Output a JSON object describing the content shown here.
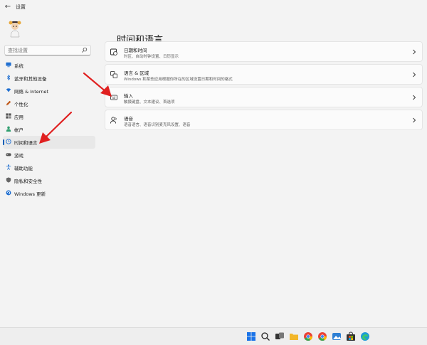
{
  "window": {
    "title": "设置"
  },
  "search": {
    "placeholder": "查找设置"
  },
  "sidebar": {
    "items": [
      {
        "label": "系统",
        "icon": "monitor-icon",
        "color": "#1f6fd1"
      },
      {
        "label": "蓝牙和其他设备",
        "icon": "bluetooth-icon",
        "color": "#1f6fd1"
      },
      {
        "label": "网络 & Internet",
        "icon": "wifi-icon",
        "color": "#1f6fd1"
      },
      {
        "label": "个性化",
        "icon": "pen-icon",
        "color": "#c05a1c"
      },
      {
        "label": "应用",
        "icon": "apps-icon",
        "color": "#555555"
      },
      {
        "label": "帐户",
        "icon": "person-icon",
        "color": "#2f9e6e"
      },
      {
        "label": "时间和语言",
        "icon": "globe-clock-icon",
        "color": "#1f6fd1",
        "selected": true
      },
      {
        "label": "游戏",
        "icon": "gamepad-icon",
        "color": "#555555"
      },
      {
        "label": "辅助功能",
        "icon": "accessibility-icon",
        "color": "#1f6fd1"
      },
      {
        "label": "隐私和安全性",
        "icon": "shield-icon",
        "color": "#555555"
      },
      {
        "label": "Windows 更新",
        "icon": "update-icon",
        "color": "#1f6fd1"
      }
    ]
  },
  "main": {
    "title": "时间和语言",
    "cards": [
      {
        "title": "日期和时间",
        "subtitle": "时区、自动时钟设置、日历显示",
        "icon": "calendar-clock-icon"
      },
      {
        "title": "语言 & 区域",
        "subtitle": "Windows 和某些应用根据你所在的区域设置日期和时间的格式",
        "icon": "language-icon"
      },
      {
        "title": "输入",
        "subtitle": "触摸键盘、文本建议、首选项",
        "icon": "keyboard-icon"
      },
      {
        "title": "语音",
        "subtitle": "语音语言、语音识别麦克风设置、语音",
        "icon": "speech-icon"
      }
    ]
  },
  "annotations": {
    "arrow_color": "#e02020"
  },
  "taskbar": {
    "icons": [
      "windows-start-icon",
      "search-icon",
      "task-view-icon",
      "file-explorer-icon",
      "chrome-icon",
      "chrome-icon",
      "photos-icon",
      "store-icon",
      "edge-icon"
    ]
  }
}
